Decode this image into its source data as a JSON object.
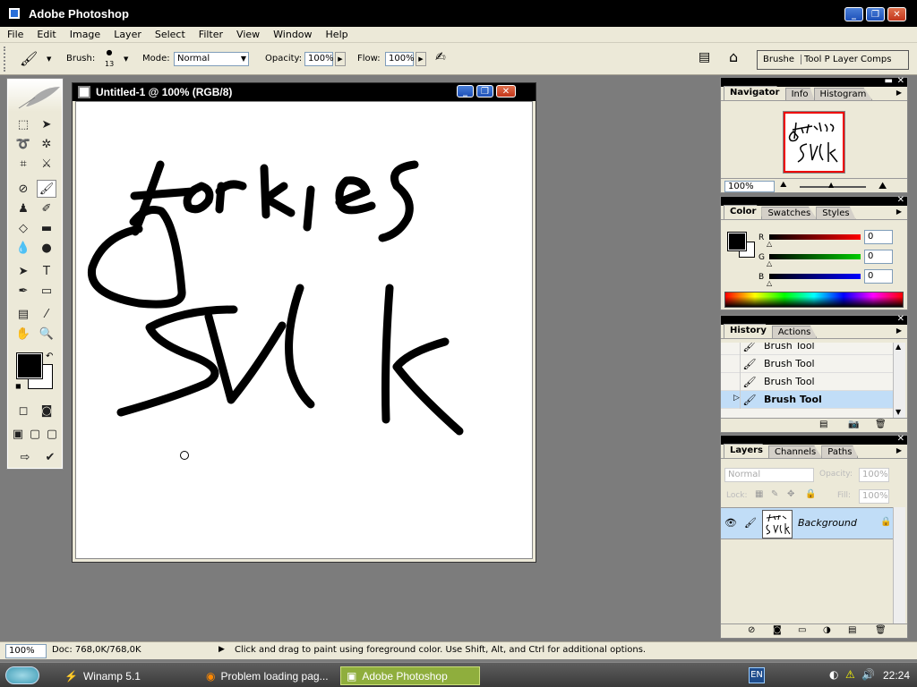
{
  "app": {
    "title": "Adobe Photoshop"
  },
  "menu": [
    "File",
    "Edit",
    "Image",
    "Layer",
    "Select",
    "Filter",
    "View",
    "Window",
    "Help"
  ],
  "options": {
    "brush_label": "Brush:",
    "brush_size": "13",
    "mode_label": "Mode:",
    "mode_value": "Normal",
    "opacity_label": "Opacity:",
    "opacity_value": "100%",
    "flow_label": "Flow:",
    "flow_value": "100%",
    "wells": [
      "Brushe",
      "Tool P",
      "Layer Comps"
    ]
  },
  "document": {
    "title": "Untitled-1 @ 100% (RGB/8)",
    "drawing_text_line1": "forkies",
    "drawing_text_line2": "SUCK"
  },
  "navigator": {
    "tabs": [
      "Navigator",
      "Info",
      "Histogram"
    ],
    "zoom": "100%"
  },
  "color": {
    "tabs": [
      "Color",
      "Swatches",
      "Styles"
    ],
    "r_label": "R",
    "g_label": "G",
    "b_label": "B",
    "r": "0",
    "g": "0",
    "b": "0"
  },
  "history": {
    "tabs": [
      "History",
      "Actions"
    ],
    "items": [
      "Brush Tool",
      "Brush Tool",
      "Brush Tool",
      "Brush Tool"
    ]
  },
  "layers": {
    "tabs": [
      "Layers",
      "Channels",
      "Paths"
    ],
    "blend": "Normal",
    "opacity_label": "Opacity:",
    "opacity": "100%",
    "lock_label": "Lock:",
    "fill_label": "Fill:",
    "fill": "100%",
    "layer_name": "Background"
  },
  "status": {
    "zoom": "100%",
    "doc": "Doc: 768,0K/768,0K",
    "hint": "Click and drag to paint using foreground color.  Use Shift, Alt, and Ctrl for additional options."
  },
  "taskbar": {
    "items": [
      "Winamp 5.1",
      "Problem loading pag...",
      "Adobe Photoshop"
    ],
    "lang": "EN",
    "time": "22:24"
  },
  "colors": {
    "accent": "#c1ddf7",
    "taskbar_active": "#8fae3d"
  }
}
